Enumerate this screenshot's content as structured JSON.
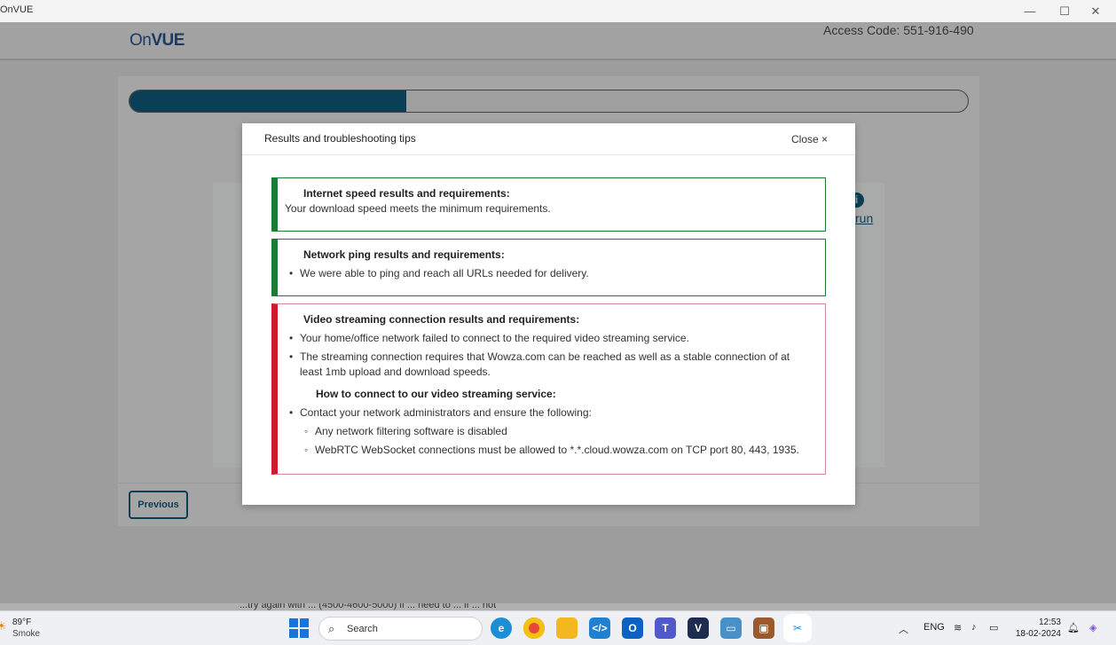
{
  "window": {
    "title": "OnVUE",
    "minimize": "—",
    "maximize": "☐",
    "close": "✕"
  },
  "header": {
    "logo_prefix": "On",
    "logo_suffix": "VUE",
    "access_code": "Access Code: 551-916-490"
  },
  "background": {
    "progress_fraction": 0.33,
    "link_text": "run",
    "previous_label": "Previous",
    "footer_partial": "...try again with ... (4500-4600-5000) if ... need to ... if ... not"
  },
  "modal": {
    "title": "Results and troubleshooting tips",
    "close_label": "Close ×",
    "internet": {
      "heading": "Internet speed results and requirements:",
      "text": "Your download speed meets the minimum requirements."
    },
    "ping": {
      "heading": "Network ping results and requirements:",
      "bullet": "We were able to ping and reach all URLs needed for delivery."
    },
    "video": {
      "heading": "Video streaming connection results and requirements:",
      "bullet1": "Your home/office network failed to connect to the required video streaming service.",
      "bullet2_line1": "The streaming connection requires that Wowza.com can be reached as well as a stable connection of at",
      "bullet2_line2": "least 1mb upload and download speeds.",
      "howto_heading": "How to connect to our video streaming service:",
      "bullet3": "Contact your network administrators and ensure the following:",
      "sub1": "Any network filtering software is disabled",
      "sub2": "WebRTC WebSocket connections must be allowed to *.*.cloud.wowza.com on TCP port 80, 443, 1935."
    }
  },
  "taskbar": {
    "weather_temp": "89°F",
    "weather_condition": "Smoke",
    "search_label": "Search",
    "apps": [
      "edge",
      "chrome",
      "file-explorer",
      "vscode",
      "outlook-new",
      "teams-new",
      "vue",
      "remote-desktop",
      "package",
      "snipping-tool"
    ],
    "lang": "ENG",
    "time": "12:53",
    "date": "18-02-2024"
  },
  "colors": {
    "accent_dark": "#0b3f55",
    "success_border": "#1e7b34",
    "fail_border": "#d21a2d"
  }
}
